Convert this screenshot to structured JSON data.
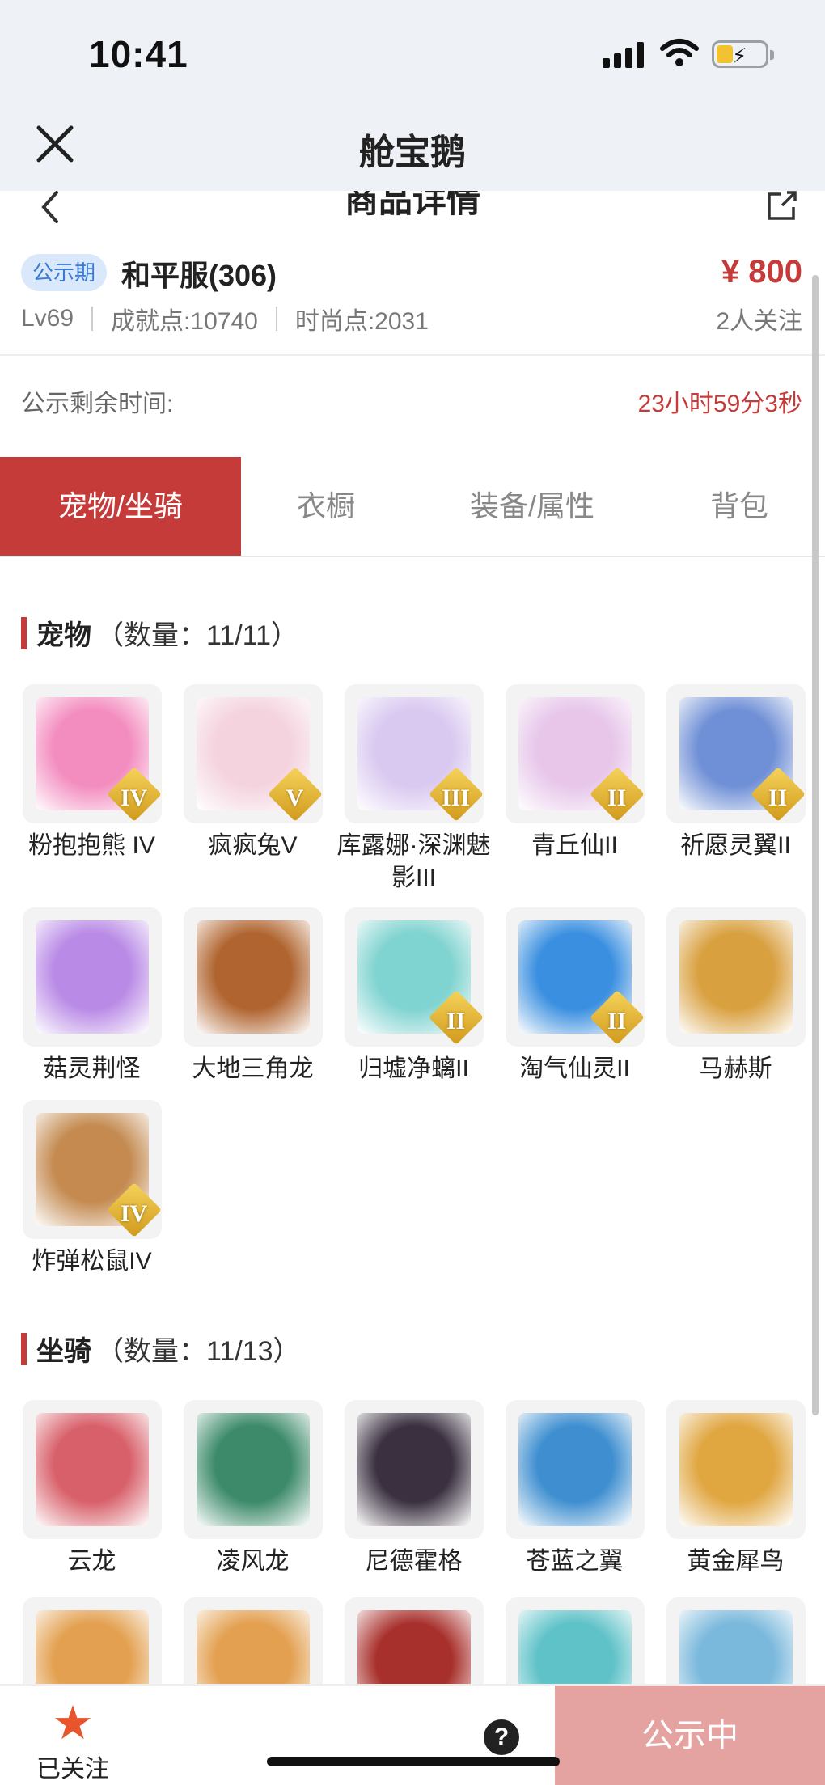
{
  "status_bar": {
    "time": "10:41"
  },
  "header": {
    "title": "舱宝鹅"
  },
  "sub_header": {
    "title": "商品详情"
  },
  "product": {
    "badge": "公示期",
    "server": "和平服(306)",
    "price": "¥ 800",
    "level": "Lv69",
    "achievement": "成就点:10740",
    "fashion": "时尚点:2031",
    "watchers": "2人关注",
    "remaining_label": "公示剩余时间:",
    "remaining_time": "23小时59分3秒"
  },
  "tabs": [
    {
      "label": "宠物/坐骑",
      "active": true
    },
    {
      "label": "衣橱",
      "active": false
    },
    {
      "label": "装备/属性",
      "active": false
    },
    {
      "label": "背包",
      "active": false
    }
  ],
  "pets": {
    "title": "宠物",
    "count": "（数量：11/11）",
    "items": [
      {
        "name": "粉抱抱熊 IV",
        "tier": "IV",
        "color": "#f38cbf"
      },
      {
        "name": "疯疯兔V",
        "tier": "V",
        "color": "#f4d3df"
      },
      {
        "name": "库露娜·深渊魅影III",
        "tier": "III",
        "color": "#d9c8f0"
      },
      {
        "name": "青丘仙II",
        "tier": "II",
        "color": "#e7c6ea"
      },
      {
        "name": "祈愿灵翼II",
        "tier": "II",
        "color": "#6f8fd6"
      },
      {
        "name": "菇灵荆怪",
        "tier": "",
        "color": "#b98ae6"
      },
      {
        "name": "大地三角龙",
        "tier": "",
        "color": "#b0642f"
      },
      {
        "name": "归墟净螭II",
        "tier": "II",
        "color": "#7fd3d0"
      },
      {
        "name": "淘气仙灵II",
        "tier": "II",
        "color": "#3a8fe0"
      },
      {
        "name": "马赫斯",
        "tier": "",
        "color": "#d9a040"
      },
      {
        "name": "炸弹松鼠IV",
        "tier": "IV",
        "color": "#c48a50"
      }
    ]
  },
  "mounts": {
    "title": "坐骑",
    "count": "（数量：11/13）",
    "items": [
      {
        "name": "云龙",
        "color": "#d8606a"
      },
      {
        "name": "凌风龙",
        "color": "#3c8a6a"
      },
      {
        "name": "尼德霍格",
        "color": "#3a3040"
      },
      {
        "name": "苍蓝之翼",
        "color": "#3f8fd0"
      },
      {
        "name": "黄金犀鸟",
        "color": "#e0a640"
      },
      {
        "name": "",
        "color": "#e3a050"
      },
      {
        "name": "",
        "color": "#e3a050"
      },
      {
        "name": "",
        "color": "#a8302c"
      },
      {
        "name": "",
        "color": "#5ec2c8"
      },
      {
        "name": "",
        "color": "#7ab8dc"
      }
    ]
  },
  "bottom_bar": {
    "follow_label": "已关注",
    "help": "?",
    "status_button": "公示中"
  }
}
